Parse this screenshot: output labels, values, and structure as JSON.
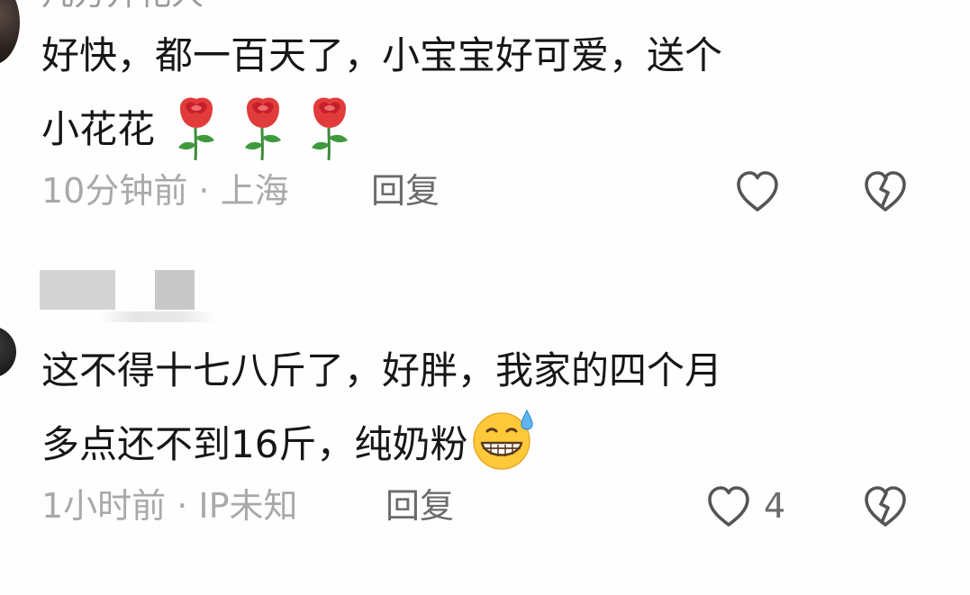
{
  "comments": [
    {
      "username": "凡方开花人",
      "text_line1": "好快，都一百天了，小宝宝好可爱，送个",
      "text_line2": "小花花",
      "emojis": [
        "rose",
        "rose",
        "rose"
      ],
      "time_location": "10分钟前 · 上海",
      "reply_label": "回复",
      "like_count": ""
    },
    {
      "text_line1": "这不得十七八斤了，好胖，我家的四个月",
      "text_line2": "多点还不到16斤，纯奶粉",
      "emojis": [
        "grinning-sweat"
      ],
      "time_location": "1小时前 · IP未知",
      "reply_label": "回复",
      "like_count": "4"
    }
  ],
  "colors": {
    "text": "#161616",
    "meta": "#a9a9a9",
    "action": "#6b6b6b",
    "icon_stroke": "#555555",
    "background": "#fefefe"
  },
  "icons": {
    "like": "heart-outline-icon",
    "dislike": "broken-heart-outline-icon"
  }
}
